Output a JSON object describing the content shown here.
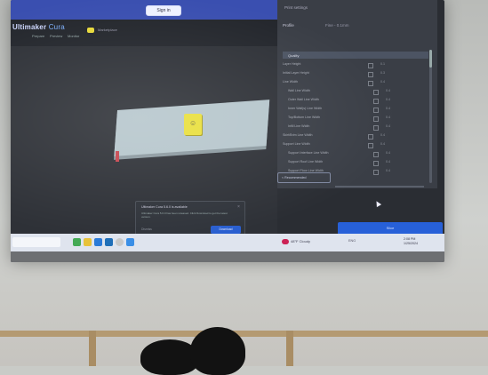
{
  "topbar": {
    "sign_in_label": "Sign in"
  },
  "app": {
    "brand_main": "Ultimaker",
    "brand_sub": "Cura",
    "tabs": [
      "Prepare",
      "Preview",
      "Monitor"
    ],
    "marketplace_label": "Marketplace"
  },
  "panel": {
    "title": "Print settings",
    "profile_label": "Profile",
    "profile_value": "Fine - 0.1mm",
    "section_label": "Quality",
    "rows": [
      {
        "label": "Layer Height",
        "value": "0.1"
      },
      {
        "label": "Initial Layer Height",
        "value": "0.3"
      },
      {
        "label": "Line Width",
        "value": "0.4"
      },
      {
        "label": "Wall Line Width",
        "value": "0.4"
      },
      {
        "label": "Outer Wall Line Width",
        "value": "0.4"
      },
      {
        "label": "Inner Wall(s) Line Width",
        "value": "0.4"
      },
      {
        "label": "Top/Bottom Line Width",
        "value": "0.4"
      },
      {
        "label": "Infill Line Width",
        "value": "0.4"
      },
      {
        "label": "Skirt/Brim Line Width",
        "value": "0.4"
      },
      {
        "label": "Support Line Width",
        "value": "0.4"
      },
      {
        "label": "Support Interface Line Width",
        "value": "0.4"
      },
      {
        "label": "Support Roof Line Width",
        "value": "0.4"
      },
      {
        "label": "Support Floor Line Width",
        "value": "0.4"
      }
    ],
    "recommended_label": "< Recommended"
  },
  "slice_label": "Slice",
  "notice": {
    "title": "Ultimaker Cura 5.6.0 is available",
    "body": "Ultimaker Cura 5.6.0 has been released. Click Download to get the latest version.",
    "dismiss_label": "Dismiss",
    "download_label": "Download"
  },
  "taskbar": {
    "weather": "48°F Cloudy",
    "tray": "ENG",
    "time": "2:08 PM",
    "date": "1/25/2024"
  }
}
